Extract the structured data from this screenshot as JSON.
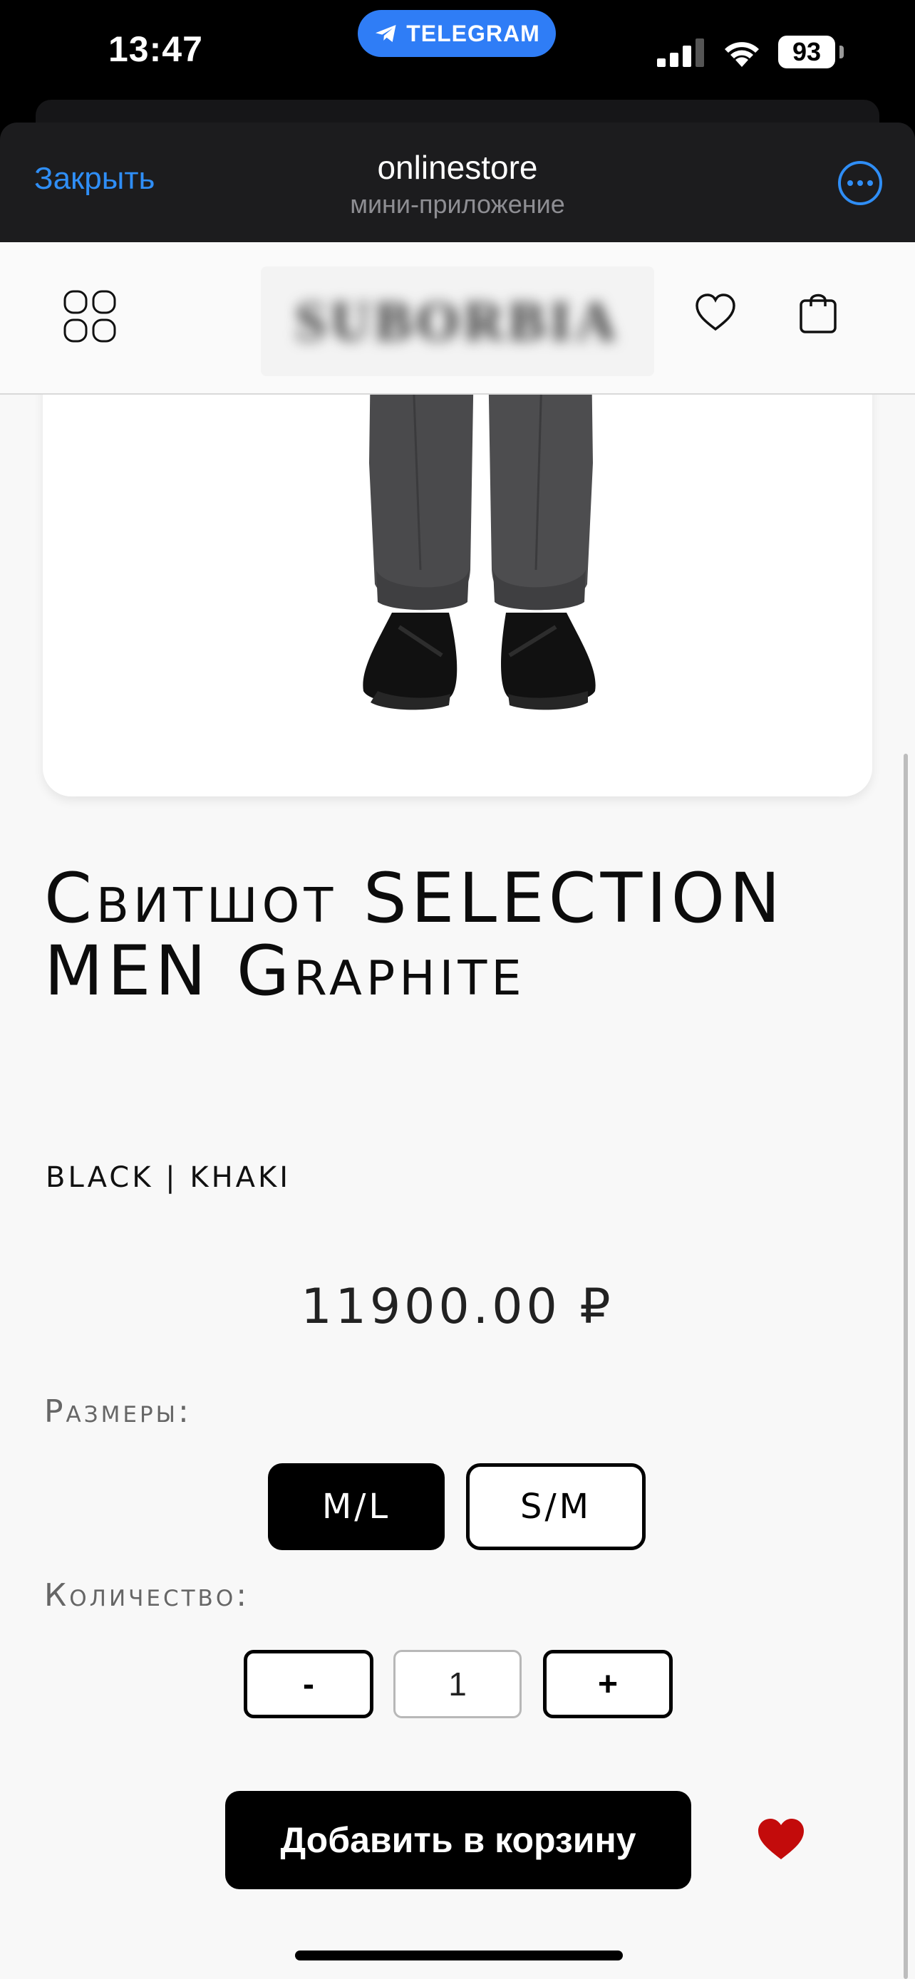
{
  "status_bar": {
    "time": "13:47",
    "telegram_label": "TELEGRAM",
    "battery": "93"
  },
  "mini_app": {
    "close_label": "Закрыть",
    "app_name": "onlinestore",
    "app_subtitle": "мини-приложение"
  },
  "store_nav": {
    "logo_text": "SUBORBIA"
  },
  "product": {
    "title": "Свитшот SELECTION MEN Graphite",
    "colors": "BLACK | KHAKI",
    "price": "11900.00 ₽",
    "sizes_label": "Размеры:",
    "sizes": [
      {
        "label": "M/L",
        "selected": true
      },
      {
        "label": "S/M",
        "selected": false
      }
    ],
    "quantity_label": "Количество:",
    "quantity_minus": "-",
    "quantity_value": "1",
    "quantity_plus": "+",
    "add_to_cart_label": "Добавить в корзину"
  },
  "colors": {
    "telegram_blue": "#2f7df6",
    "link_blue": "#2f8ef6",
    "favorite_red": "#c30b0b",
    "primary_black": "#000000"
  }
}
